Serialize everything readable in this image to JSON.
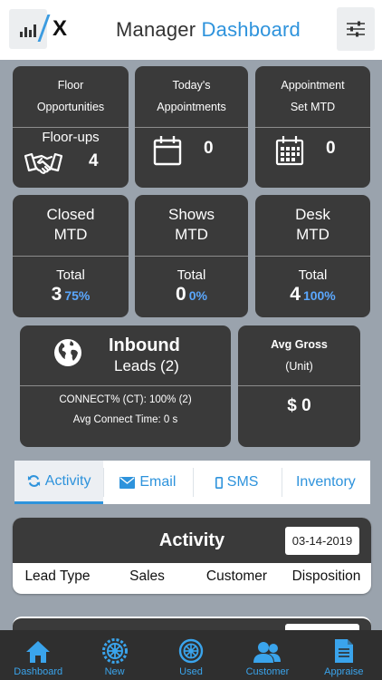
{
  "header": {
    "brand_letter": "X",
    "title_plain": "Manager",
    "title_accent": "Dashboard"
  },
  "tiles": {
    "floor": {
      "line1": "Floor",
      "line2": "Opportunities",
      "sublabel": "Floor-ups",
      "value": "4",
      "icon": "handshake-icon"
    },
    "today": {
      "line1": "Today's",
      "line2": "Appointments",
      "value": "0",
      "icon": "calendar-icon"
    },
    "appt_set": {
      "line1": "Appointment",
      "line2": "Set MTD",
      "value": "0",
      "icon": "calendar-grid-icon"
    },
    "closed": {
      "line1": "Closed",
      "line2": "MTD",
      "total_label": "Total",
      "total": "3",
      "percent": "75%"
    },
    "shows": {
      "line1": "Shows",
      "line2": "MTD",
      "total_label": "Total",
      "total": "0",
      "percent": "0%"
    },
    "desk": {
      "line1": "Desk",
      "line2": "MTD",
      "total_label": "Total",
      "total": "4",
      "percent": "100%"
    }
  },
  "inbound": {
    "title": "Inbound",
    "subtitle": "Leads (2)",
    "connect": "CONNECT% (CT): 100% (2)",
    "avg_connect": "Avg Connect Time: 0 s",
    "icon": "globe-icon"
  },
  "avg_gross": {
    "line1": "Avg Gross",
    "line2": "(Unit)",
    "value": "$ 0"
  },
  "tabs": [
    {
      "label": "Activity",
      "icon": "refresh-icon",
      "active": true
    },
    {
      "label": "Email",
      "icon": "envelope-icon",
      "active": false
    },
    {
      "label": "SMS",
      "icon": "mobile-icon",
      "active": false
    },
    {
      "label": "Inventory",
      "icon": "",
      "active": false
    }
  ],
  "activity": {
    "title": "Activity",
    "date": "03-14-2019",
    "columns": [
      "Lead Type",
      "Sales",
      "Customer",
      "Disposition"
    ]
  },
  "bottom_nav": [
    {
      "label": "Dashboard",
      "icon": "home-icon"
    },
    {
      "label": "New",
      "icon": "tire-icon"
    },
    {
      "label": "Used",
      "icon": "tire-outline-icon"
    },
    {
      "label": "Customer",
      "icon": "users-icon"
    },
    {
      "label": "Appraise",
      "icon": "document-icon"
    }
  ],
  "colors": {
    "accent": "#2e93dc",
    "tile_bg": "#3a3a3a",
    "page_bg": "#9aa3ad",
    "percent": "#5ba8ff"
  }
}
